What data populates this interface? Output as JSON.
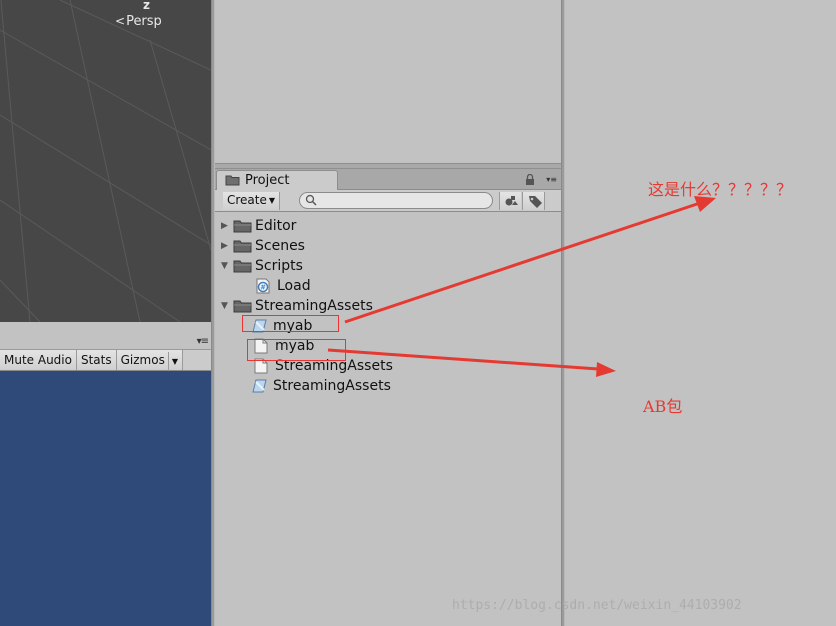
{
  "scene": {
    "axis_label": "z",
    "persp_label": "Persp"
  },
  "game": {
    "toolbar": {
      "mute_audio": "Mute Audio",
      "stats": "Stats",
      "gizmos": "Gizmos"
    },
    "background_color": "#2f4a78"
  },
  "project": {
    "tab_label": "Project",
    "create_label": "Create",
    "search_placeholder": "",
    "tree": [
      {
        "label": "Editor",
        "type": "folder",
        "expanded": false
      },
      {
        "label": "Scenes",
        "type": "folder",
        "expanded": false
      },
      {
        "label": "Scripts",
        "type": "folder",
        "expanded": true
      },
      {
        "label": "Load",
        "type": "csharp-script"
      },
      {
        "label": "StreamingAssets",
        "type": "folder",
        "expanded": true
      },
      {
        "label": "myab",
        "type": "assetbundle"
      },
      {
        "label": "myab",
        "type": "file"
      },
      {
        "label": "StreamingAssets",
        "type": "file"
      },
      {
        "label": "StreamingAssets",
        "type": "assetbundle"
      }
    ]
  },
  "annotations": {
    "question": "这是什么？？？？？",
    "ab_label": "AB包",
    "color": "#e53a32"
  },
  "watermark": "https://blog.csdn.net/weixin_44103902"
}
